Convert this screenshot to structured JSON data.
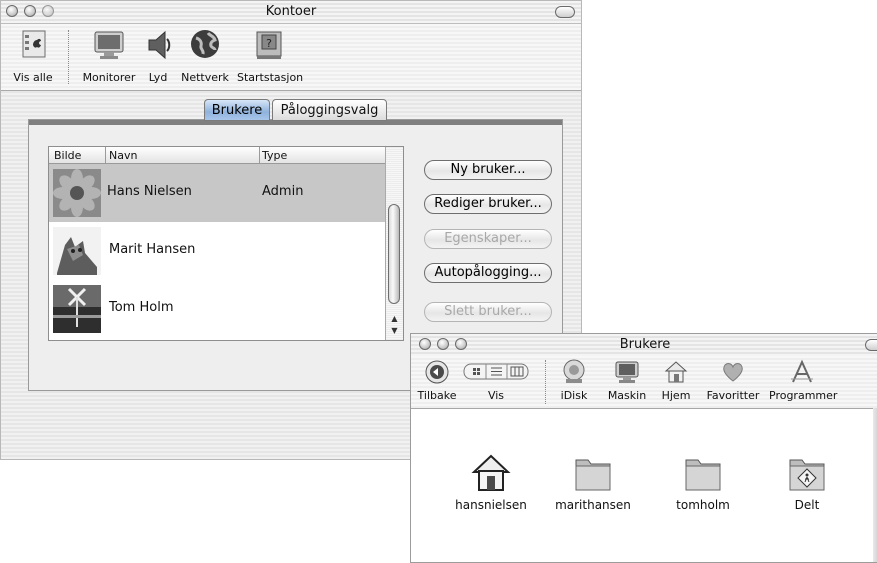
{
  "accounts_window": {
    "title": "Kontoer",
    "toolbar": [
      {
        "label": "Vis alle",
        "icon": "apple-icon"
      },
      {
        "label": "Monitorer",
        "icon": "monitor-icon"
      },
      {
        "label": "Lyd",
        "icon": "speaker-icon"
      },
      {
        "label": "Nettverk",
        "icon": "globe-icon"
      },
      {
        "label": "Startstasjon",
        "icon": "disk-icon"
      }
    ],
    "tabs": [
      {
        "label": "Brukere",
        "selected": true
      },
      {
        "label": "Påloggingsvalg",
        "selected": false
      }
    ],
    "table": {
      "columns": [
        "Bilde",
        "Navn",
        "Type"
      ],
      "rows": [
        {
          "picture": "flower-picture",
          "name": "Hans Nielsen",
          "type": "Admin",
          "selected": true
        },
        {
          "picture": "cat-picture",
          "name": "Marit Hansen",
          "type": "",
          "selected": false
        },
        {
          "picture": "sign-picture",
          "name": "Tom Holm",
          "type": "",
          "selected": false
        }
      ]
    },
    "buttons": [
      {
        "label": "Ny bruker...",
        "enabled": true
      },
      {
        "label": "Rediger bruker...",
        "enabled": true
      },
      {
        "label": "Egenskaper...",
        "enabled": false
      },
      {
        "label": "Autopålogging...",
        "enabled": true
      },
      {
        "label": "Slett bruker...",
        "enabled": false
      }
    ]
  },
  "users_window": {
    "title": "Brukere",
    "toolbar": {
      "back": "Tilbake",
      "view": "Vis",
      "items": [
        {
          "label": "iDisk",
          "icon": "idisk-icon"
        },
        {
          "label": "Maskin",
          "icon": "computer-icon"
        },
        {
          "label": "Hjem",
          "icon": "home-icon"
        },
        {
          "label": "Favoritter",
          "icon": "heart-icon"
        },
        {
          "label": "Programmer",
          "icon": "applications-icon"
        }
      ]
    },
    "folders": [
      {
        "label": "hansnielsen",
        "icon": "home-folder-icon"
      },
      {
        "label": "marithansen",
        "icon": "folder-icon"
      },
      {
        "label": "tomholm",
        "icon": "folder-icon"
      },
      {
        "label": "Delt",
        "icon": "shared-folder-icon"
      }
    ]
  }
}
